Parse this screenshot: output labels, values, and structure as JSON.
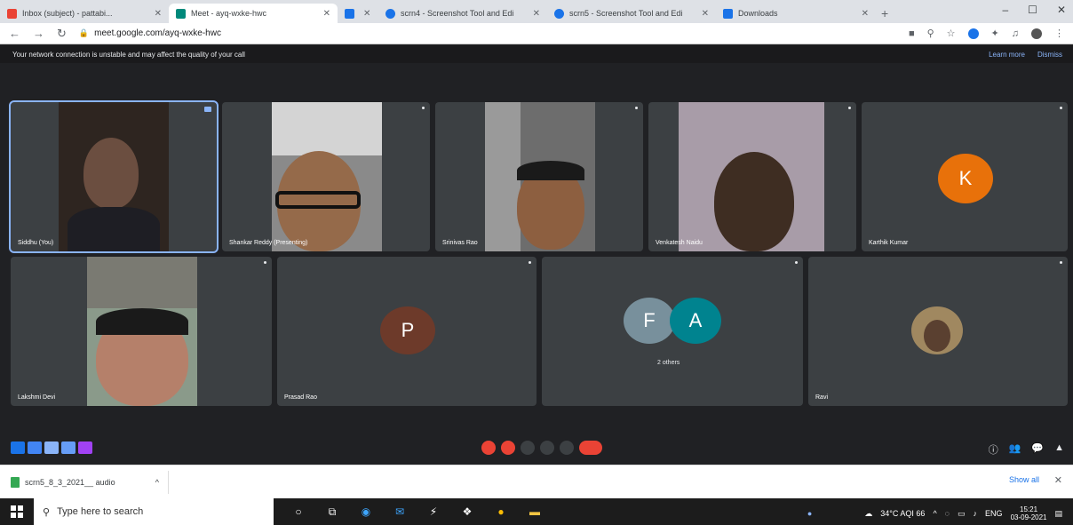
{
  "browser": {
    "tabs": [
      {
        "title": "Inbox (subject) - pattabi...",
        "color": "#ea4335"
      },
      {
        "title": "Meet - ayq-wxke-hwc",
        "color": "#00897b",
        "active": true
      },
      {
        "title": "",
        "color": "#1a73e8"
      },
      {
        "title": "scrn4 - Screenshot Tool and Edi",
        "color": "#1a73e8"
      },
      {
        "title": "scrn5 - Screenshot Tool and Edi",
        "color": "#1a73e8"
      },
      {
        "title": "Downloads",
        "color": "#1a73e8"
      }
    ],
    "address": "meet.google.com/ayq-wxke-hwc",
    "window_controls": [
      "–",
      "☐",
      "✕"
    ]
  },
  "meet": {
    "banner_text": "Your network connection is unstable and may affect the quality of your call",
    "banner_links": [
      "Learn more",
      "Dismiss"
    ],
    "participants": [
      {
        "name": "Siddhu (You)",
        "type": "video",
        "tone": "#3a2a22",
        "skin": "#7a5a4a",
        "selected": true
      },
      {
        "name": "Shankar Reddy (Presenting)",
        "type": "video",
        "tone": "#8a8a8a",
        "skin": "#9a7050"
      },
      {
        "name": "Srinivas Rao",
        "type": "video",
        "tone": "#6a6a6a",
        "skin": "#9a6b48"
      },
      {
        "name": "Venkatesh Naidu",
        "type": "video",
        "tone": "#a59aa6",
        "skin": "#4a3528"
      },
      {
        "name": "Karthik Kumar",
        "type": "avatar",
        "letter": "K",
        "color": "#e8710a"
      },
      {
        "name": "Lakshmi Devi",
        "type": "video",
        "tone": "#9aa59a",
        "skin": "#b07a64"
      },
      {
        "name": "Prasad Rao",
        "type": "avatar",
        "letter": "P",
        "color": "#6d3a2a"
      },
      {
        "name": "",
        "type": "group",
        "letters": [
          "F",
          "A"
        ],
        "colors": [
          "#78909c",
          "#00838f"
        ],
        "label": "2 others"
      },
      {
        "name": "Ravi",
        "type": "photo",
        "color": "#a08860"
      }
    ],
    "control_colors": [
      "#1a73e8",
      "#4285f4",
      "#8ab4f8",
      "#669df6",
      "#a142f4"
    ],
    "center_buttons": [
      "🎤",
      "📷",
      "CC",
      "✋",
      "⇧",
      "⋮",
      "☎"
    ],
    "right_icons": [
      "ⓘ",
      "👥",
      "💬",
      "▲"
    ]
  },
  "downloads": {
    "item": "scrn5_8_3_2021__ audio",
    "show_all": "Show all",
    "close": "✕"
  },
  "taskbar": {
    "search_placeholder": "Type here to search",
    "weather": "34°C AQI 66",
    "lang": "ENG",
    "time": "15:21",
    "date": "03-09-2021"
  }
}
